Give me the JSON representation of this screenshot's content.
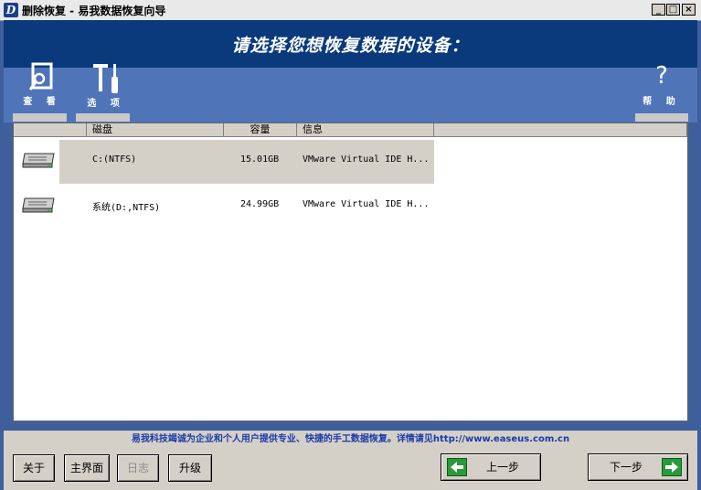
{
  "window": {
    "title": "删除恢复 - 易我数据恢复向导",
    "app_icon_letter": "D",
    "min_label": "_",
    "max_label": "□",
    "close_label": "×"
  },
  "banner": {
    "text": "请选择您想恢复数据的设备："
  },
  "toolbar": {
    "view": {
      "label": "查 看",
      "icon": "view-icon"
    },
    "options": {
      "label": "选 项",
      "icon": "tools-icon"
    },
    "help": {
      "label": "帮 助",
      "icon": "help-icon",
      "glyph": "?"
    }
  },
  "list": {
    "columns": [
      "磁盘",
      "容量",
      "信息"
    ],
    "rows": [
      {
        "disk": "C:(NTFS)",
        "capacity": "15.01GB",
        "info": "VMware Virtual IDE H...",
        "selected": true
      },
      {
        "disk": "系统(D:,NTFS)",
        "capacity": "24.99GB",
        "info": "VMware Virtual IDE H...",
        "selected": false
      }
    ]
  },
  "status": {
    "text": "易我科技竭诚为企业和个人用户提供专业、快捷的手工数据恢复。详情请见http://www.easeus.com.cn"
  },
  "buttons": {
    "about": "关于",
    "home": "主界面",
    "log": "日志",
    "upgrade": "升级",
    "prev": "上一步",
    "next": "下一步"
  },
  "colors": {
    "banner": "#0a3a7c",
    "toolbar": "#4f75b8",
    "status_text": "#1a3aa8",
    "arrow": "#2a9a3a"
  }
}
